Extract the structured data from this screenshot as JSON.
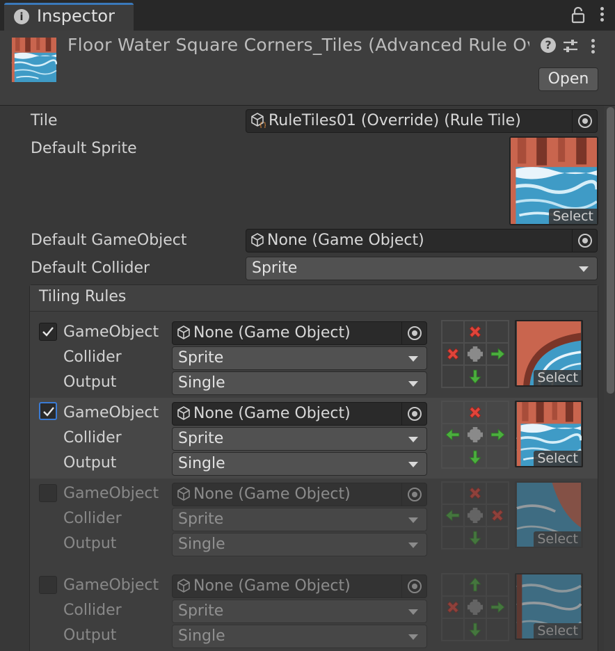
{
  "tab": {
    "title": "Inspector"
  },
  "header": {
    "asset_name": "Floor Water Square Corners_Tiles (Advanced Rule Override)",
    "open_label": "Open"
  },
  "fields": {
    "tile_label": "Tile",
    "tile_value": "RuleTiles01 (Override) (Rule Tile)",
    "default_sprite_label": "Default Sprite",
    "select_label": "Select",
    "default_gameobject_label": "Default GameObject",
    "default_gameobject_value": "None (Game Object)",
    "default_collider_label": "Default Collider",
    "default_collider_value": "Sprite"
  },
  "tiling_rules": {
    "title": "Tiling Rules",
    "rules": [
      {
        "enabled": true,
        "gameobject_label": "GameObject",
        "gameobject_value": "None (Game Object)",
        "collider_label": "Collider",
        "collider_value": "Sprite",
        "output_label": "Output",
        "output_value": "Single",
        "select_label": "Select",
        "neighbors": [
          "",
          "x",
          "",
          "x",
          "center",
          "right",
          "",
          "down",
          ""
        ]
      },
      {
        "enabled": true,
        "gameobject_label": "GameObject",
        "gameobject_value": "None (Game Object)",
        "collider_label": "Collider",
        "collider_value": "Sprite",
        "output_label": "Output",
        "output_value": "Single",
        "select_label": "Select",
        "neighbors": [
          "",
          "x",
          "",
          "left",
          "center",
          "right",
          "",
          "down",
          ""
        ]
      },
      {
        "enabled": false,
        "gameobject_label": "GameObject",
        "gameobject_value": "None (Game Object)",
        "collider_label": "Collider",
        "collider_value": "Sprite",
        "output_label": "Output",
        "output_value": "Single",
        "select_label": "Select",
        "neighbors": [
          "",
          "x",
          "",
          "left",
          "center",
          "x",
          "",
          "down",
          ""
        ]
      },
      {
        "enabled": false,
        "gameobject_label": "GameObject",
        "gameobject_value": "None (Game Object)",
        "collider_label": "Collider",
        "collider_value": "Sprite",
        "output_label": "Output",
        "output_value": "Single",
        "select_label": "Select",
        "neighbors": [
          "",
          "up",
          "",
          "x",
          "center",
          "right",
          "",
          "down",
          ""
        ]
      }
    ]
  },
  "colors": {
    "accent": "#3a79bb",
    "arrow_green": "#4caf3e",
    "cross_red": "#e0443a",
    "water": "#3f9bc6",
    "rock": "#c9654e"
  }
}
